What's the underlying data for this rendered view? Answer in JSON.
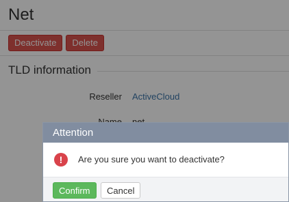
{
  "page": {
    "title": "Net",
    "actions": {
      "deactivate_label": "Deactivate",
      "delete_label": "Delete"
    },
    "section_title": "TLD information",
    "fields": {
      "reseller_label": "Reseller",
      "reseller_value": "ActiveCloud",
      "name_label": "Name",
      "name_value": "net"
    }
  },
  "dialog": {
    "title": "Attention",
    "icon": "exclamation-icon",
    "message": "Are you sure you want to deactivate?",
    "confirm_label": "Confirm",
    "cancel_label": "Cancel"
  },
  "colors": {
    "danger": "#d9534f",
    "confirm": "#5cb85c",
    "dialog_header": "#818da0",
    "link": "#3b74a8"
  }
}
